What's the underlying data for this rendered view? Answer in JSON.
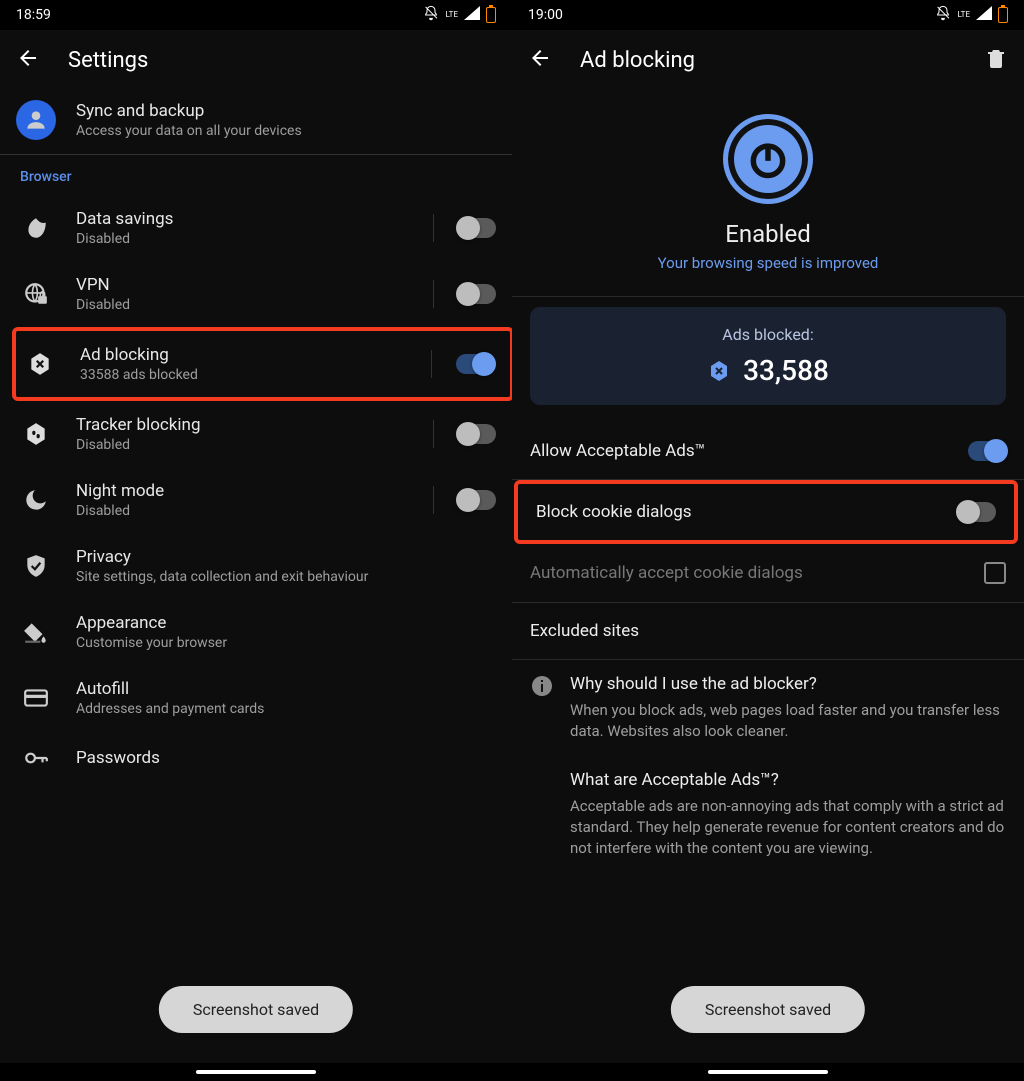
{
  "left": {
    "status": {
      "time": "18:59",
      "network": "LTE"
    },
    "header": {
      "title": "Settings"
    },
    "sync": {
      "title": "Sync and backup",
      "subtitle": "Access your data on all your devices"
    },
    "section_browser": "Browser",
    "items": {
      "data_savings": {
        "title": "Data savings",
        "subtitle": "Disabled",
        "toggle": false
      },
      "vpn": {
        "title": "VPN",
        "subtitle": "Disabled",
        "toggle": false
      },
      "ad_blocking": {
        "title": "Ad blocking",
        "subtitle": "33588 ads blocked",
        "toggle": true
      },
      "tracker": {
        "title": "Tracker blocking",
        "subtitle": "Disabled",
        "toggle": false
      },
      "night": {
        "title": "Night mode",
        "subtitle": "Disabled",
        "toggle": false
      },
      "privacy": {
        "title": "Privacy",
        "subtitle": "Site settings, data collection and exit behaviour"
      },
      "appearance": {
        "title": "Appearance",
        "subtitle": "Customise your browser"
      },
      "autofill": {
        "title": "Autofill",
        "subtitle": "Addresses and payment cards"
      },
      "passwords": {
        "title": "Passwords"
      }
    },
    "toast": "Screenshot saved"
  },
  "right": {
    "status": {
      "time": "19:00",
      "network": "LTE"
    },
    "header": {
      "title": "Ad blocking"
    },
    "hero": {
      "status": "Enabled",
      "subtitle": "Your browsing speed is improved"
    },
    "stats": {
      "label": "Ads blocked:",
      "value": "33,588"
    },
    "rows": {
      "acceptable": {
        "label": "Allow Acceptable Ads™",
        "toggle": true
      },
      "block_cookie": {
        "label": "Block cookie dialogs",
        "toggle": false
      },
      "auto_accept": {
        "label": "Automatically accept cookie dialogs",
        "checked": false
      },
      "excluded": {
        "label": "Excluded sites"
      }
    },
    "info1": {
      "q": "Why should I use the ad blocker?",
      "a": "When you block ads, web pages load faster and you transfer less data. Websites also look cleaner."
    },
    "info2": {
      "q": "What are Acceptable Ads™?",
      "a": "Acceptable ads are non-annoying ads that comply with a strict ad standard. They help generate revenue for content creators and do not interfere with the content you are viewing."
    },
    "toast": "Screenshot saved"
  }
}
